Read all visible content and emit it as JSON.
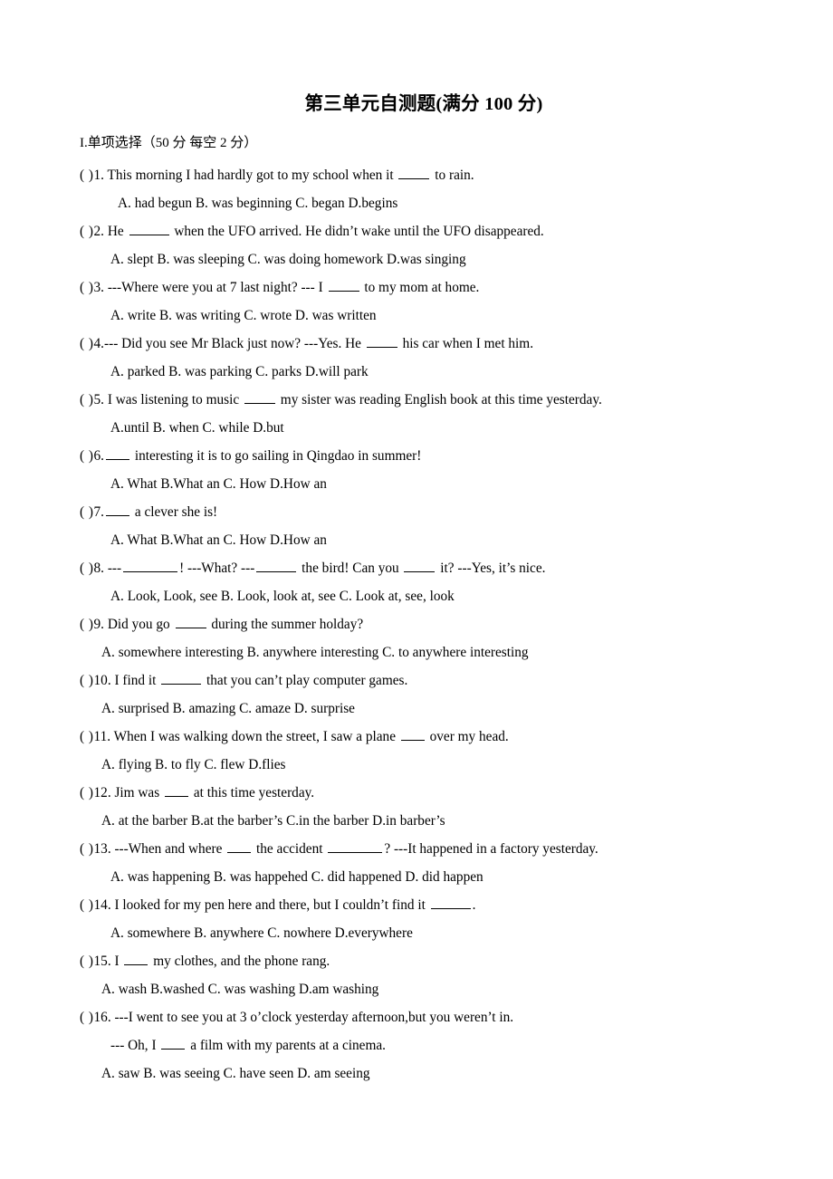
{
  "document": {
    "title": "第三单元自测题(满分 100 分)",
    "section_heading": "I.单项选择（50 分 每空 2 分）"
  },
  "questions": [
    {
      "marker": "(  )",
      "number": "1.",
      "stem_before": " This morning I had hardly got to my school when it ",
      "stem_after": " to rain.",
      "options": "A. had begun   B. was beginning   C. began   D.begins"
    },
    {
      "marker": "(  )",
      "number": "2.",
      "stem_before": " He ",
      "stem_after": " when the UFO arrived. He didn’t wake until the UFO disappeared.",
      "options": "A. slept   B. was sleeping   C. was doing homework   D.was singing"
    },
    {
      "marker": "(  )",
      "number": "3.",
      "stem_before": " ---Where were you at 7 last night? --- I ",
      "stem_after": " to my mom at home.",
      "options": "A. write   B. was writing   C. wrote   D. was written"
    },
    {
      "marker": "(  )",
      "number": "4.",
      "stem_before": "--- Did you see Mr Black just now? ---Yes. He ",
      "stem_after": " his car when I met him.",
      "options": "A. parked   B. was parking   C. parks   D.will park"
    },
    {
      "marker": "(  )",
      "number": "5.",
      "stem_before": " I was listening to music ",
      "stem_after": " my sister was reading English book at this time yesterday.",
      "options": "A.until    B. when   C. while   D.but"
    },
    {
      "marker": "(  )",
      "number": "6.",
      "stem_before": "",
      "stem_after": " interesting it is to go sailing in Qingdao in summer!",
      "options": "A. What   B.What an    C. How   D.How an"
    },
    {
      "marker": "(  )",
      "number": "7.",
      "stem_before": " ",
      "stem_after": " a clever   she is!",
      "options": "A. What   B.What an    C. How   D.How an"
    },
    {
      "marker": "(  )",
      "number": "8.",
      "stem_parts": [
        " ---",
        "! ---What? ---",
        " the bird! Can you ",
        " it? ---Yes, it’s nice."
      ],
      "options": "A.  Look, Look, see B. Look, look at, see   C. Look at, see, look"
    },
    {
      "marker": "(  )",
      "number": "9.",
      "stem_before": " Did you go ",
      "stem_after": " during the summer holday?",
      "options": "A. somewhere interesting    B. anywhere interesting   C. to anywhere interesting"
    },
    {
      "marker": "(  )",
      "number": "10.",
      "stem_before": " I find it ",
      "stem_after": " that you can’t play computer games.",
      "options": "A. surprised   B. amazing     C. amaze    D. surprise"
    },
    {
      "marker": "(  )",
      "number": "11.",
      "stem_before": " When I was walking down the street, I saw a plane ",
      "stem_after": " over my head.",
      "options": "A. flying   B. to fly    C. flew   D.flies"
    },
    {
      "marker": "(  )",
      "number": "12.",
      "stem_before": " Jim was ",
      "stem_after": " at this time yesterday.",
      "options": "A. at the barber B.at the barber’s    C.in the barber   D.in barber’s"
    },
    {
      "marker": "(  )",
      "number": "13.",
      "stem_parts": [
        " ---When and where ",
        " the accident ",
        "? ---It happened in a factory yesterday."
      ],
      "options": "A. was happening   B. was happehed   C. did happened   D. did happen"
    },
    {
      "marker": "(  )",
      "number": "14.",
      "stem_before": " I looked for my pen here and there, but I couldn’t find it ",
      "stem_after": ".",
      "options": "A.  somewhere   B. anywhere   C. nowhere   D.everywhere"
    },
    {
      "marker": "(  )",
      "number": "15.",
      "stem_before": " I ",
      "stem_after": " my clothes, and the phone rang.",
      "options": "A. wash    B.washed    C. was washing    D.am washing"
    },
    {
      "marker": "(  )",
      "number": "16.",
      "stem_before": " ---I went to see you at 3 o’clock yesterday afternoon,but you weren’t in.",
      "stem_after": "",
      "sub_before": "--- Oh, I ",
      "sub_after": " a film with my parents at a cinema.",
      "options": "A. saw   B. was seeing    C. have seen   D. am seeing"
    }
  ]
}
